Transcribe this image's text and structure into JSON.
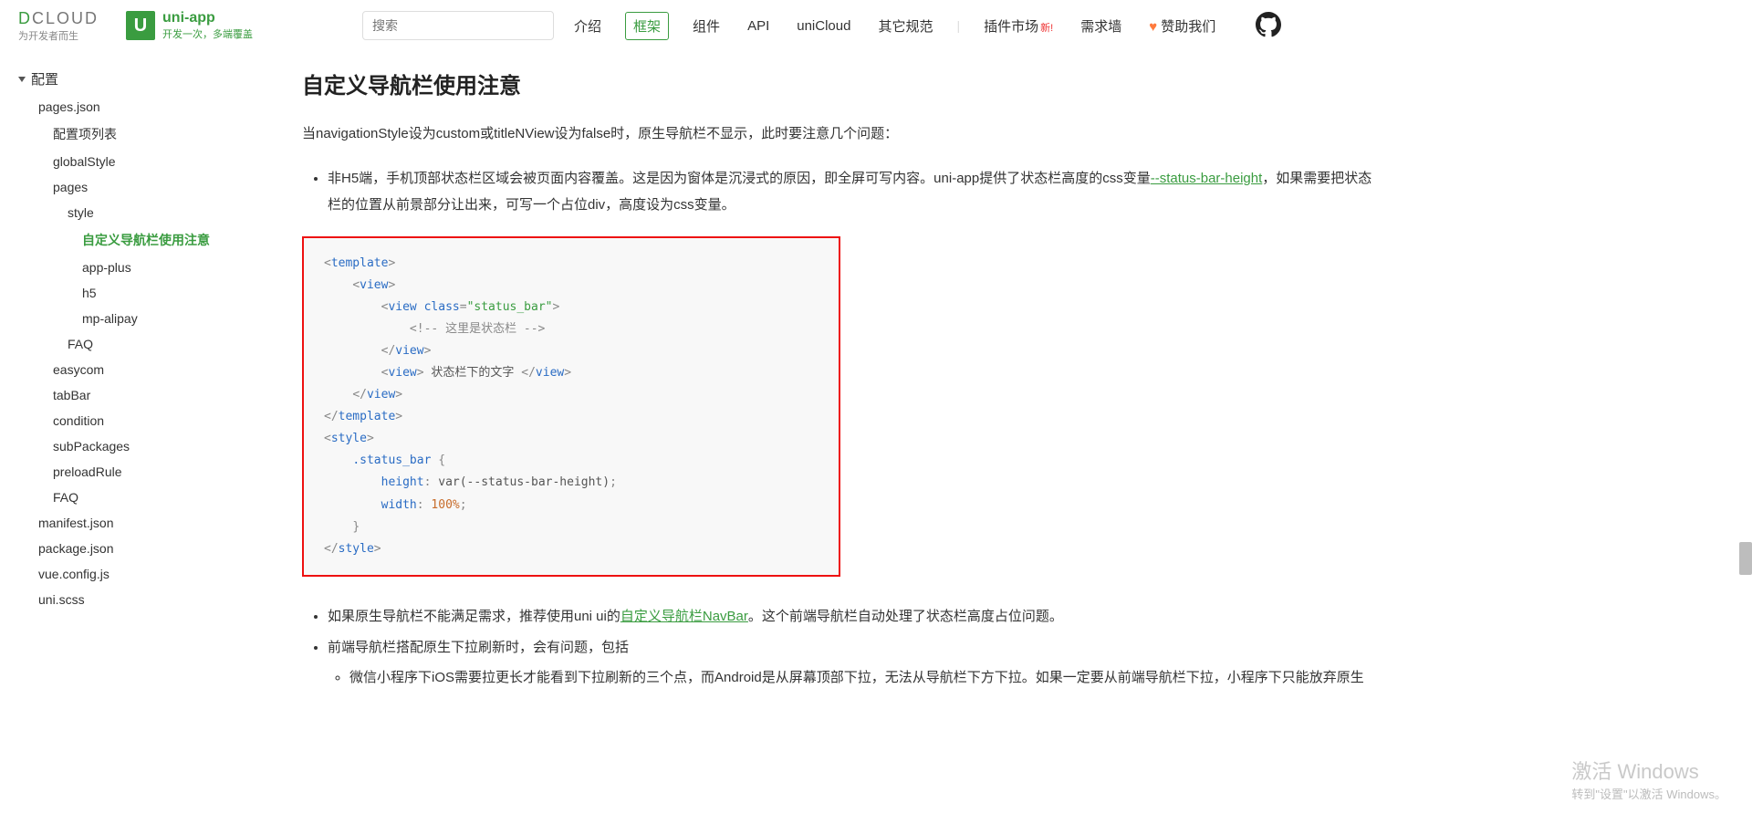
{
  "header": {
    "dcloud_brand_prefix": "D",
    "dcloud_brand_rest": "CLOUD",
    "dcloud_tagline": "为开发者而生",
    "uniapp_title": "uni-app",
    "uniapp_sub": "开发一次，多端覆盖",
    "uniapp_badge": "U",
    "search_placeholder": "搜索",
    "nav": {
      "intro": "介绍",
      "framework": "框架",
      "component": "组件",
      "api": "API",
      "unicloud": "uniCloud",
      "other": "其它规范",
      "market": "插件市场",
      "market_new": "新!",
      "demand": "需求墙",
      "sponsor": "赞助我们"
    }
  },
  "sidebar": {
    "root": "配置",
    "items": {
      "pagesjson": "pages.json",
      "configtable": "配置项列表",
      "globalstyle": "globalStyle",
      "pages": "pages",
      "style": "style",
      "customnav": "自定义导航栏使用注意",
      "appplus": "app-plus",
      "h5": "h5",
      "mpalipay": "mp-alipay",
      "faq1": "FAQ",
      "easycom": "easycom",
      "tabbar": "tabBar",
      "condition": "condition",
      "subpackages": "subPackages",
      "preloadrule": "preloadRule",
      "faq2": "FAQ",
      "manifest": "manifest.json",
      "packagejson": "package.json",
      "vueconfig": "vue.config.js",
      "uniscss": "uni.scss"
    }
  },
  "content": {
    "title": "自定义导航栏使用注意",
    "lead": "当navigationStyle设为custom或titleNView设为false时，原生导航栏不显示，此时要注意几个问题：",
    "bullet1_a": "非H5端，手机顶部状态栏区域会被页面内容覆盖。这是因为窗体是沉浸式的原因，即全屏可写内容。uni-app提供了状态栏高度的css变量",
    "bullet1_link": "--status-bar-height",
    "bullet1_b": "，如果需要把状态栏的位置从前景部分让出来，可写一个占位div，高度设为css变量。",
    "bullet2_a": "如果原生导航栏不能满足需求，推荐使用uni ui的",
    "bullet2_link": "自定义导航栏NavBar",
    "bullet2_b": "。这个前端导航栏自动处理了状态栏高度占位问题。",
    "bullet3": "前端导航栏搭配原生下拉刷新时，会有问题，包括",
    "bullet3_sub": "微信小程序下iOS需要拉更长才能看到下拉刷新的三个点，而Android是从屏幕顶部下拉，无法从导航栏下方下拉。如果一定要从前端导航栏下拉，小程序下只能放弃原生",
    "code": {
      "comment_statusbar": "这里是状态栏",
      "text_below": "状态栏下的文字",
      "class_val": "status_bar",
      "height_val": "var(--status-bar-height)",
      "width_val": "100%"
    }
  },
  "watermark": {
    "line1": "激活 Windows",
    "line2": "转到\"设置\"以激活 Windows。"
  }
}
